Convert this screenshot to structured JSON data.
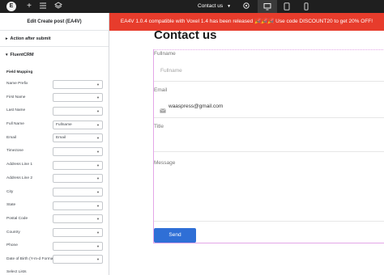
{
  "topbar": {
    "logo": "E",
    "page_name": "Contact us",
    "icons": [
      "elementor-logo-icon",
      "plus-icon",
      "structure-icon",
      "layers-icon",
      "chevron-down-icon",
      "settings-icon",
      "desktop-icon",
      "tablet-icon",
      "mobile-icon"
    ]
  },
  "panel": {
    "title": "Edit Create post (EA4V)",
    "sections": [
      {
        "label": "Action after submit",
        "open": false
      },
      {
        "label": "FluentCRM",
        "open": true
      }
    ],
    "field_mapping_heading": "Field Mapping",
    "fields": [
      {
        "label": "Name Prefix",
        "value": ""
      },
      {
        "label": "First Name",
        "value": ""
      },
      {
        "label": "Last Name",
        "value": ""
      },
      {
        "label": "Full Name",
        "value": "Fullname"
      },
      {
        "label": "Email",
        "value": "Email"
      },
      {
        "label": "Timezone",
        "value": ""
      },
      {
        "label": "Address Line 1",
        "value": ""
      },
      {
        "label": "Address Line 2",
        "value": ""
      },
      {
        "label": "City",
        "value": ""
      },
      {
        "label": "State",
        "value": ""
      },
      {
        "label": "Postal Code",
        "value": ""
      },
      {
        "label": "Country",
        "value": ""
      },
      {
        "label": "Phone",
        "value": ""
      },
      {
        "label": "Date of Birth (Y-m-d Format only)",
        "value": ""
      }
    ],
    "select_lists_label": "Select Lists"
  },
  "banner": {
    "text": "EA4V 1.0.4 compatible with Voxel 1.4 has been released 🎉🎉🎉 Use code DISCOUNT20 to get 20% OFF!",
    "color": "#e73c2c"
  },
  "form": {
    "title": "Contact us",
    "fullname_label": "Fullname",
    "fullname_placeholder": "Fullname",
    "email_label": "Email",
    "email_value": "waaspress@gmail.com",
    "title_label": "Title",
    "message_label": "Message",
    "send_label": "Send",
    "button_color": "#2f6fd6"
  }
}
